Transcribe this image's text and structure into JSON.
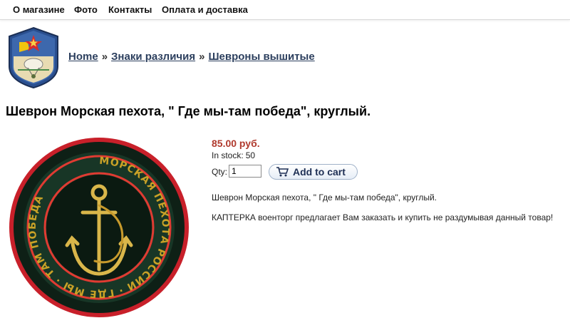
{
  "nav": {
    "items": [
      {
        "label": "О магазине"
      },
      {
        "label": "Фото"
      },
      {
        "label": "Контакты"
      },
      {
        "label": "Оплата и доставка"
      }
    ]
  },
  "breadcrumb": {
    "items": [
      {
        "label": "Home"
      },
      {
        "label": "Знаки различия"
      },
      {
        "label": "Шевроны вышитые"
      }
    ],
    "separator": "»"
  },
  "product": {
    "title": "Шеврон Морская пехота, \" Где мы-там победа\", круглый.",
    "price": "85.00 руб.",
    "stock_label": "In stock:",
    "stock_value": "50",
    "qty_label": "Qty:",
    "qty_value": "1",
    "add_to_cart_label": "Add to cart",
    "description": "Шеврон Морская пехота, \" Где мы-там победа\", круглый.",
    "promo": "КАПТЕРКА военторг предлагает Вам заказать и купить не раздумывая данный товар!",
    "patch_text": "МОРСКАЯ ПЕХОТА РОССИИ · ГДЕ МЫ · ТАМ ПОБЕДА"
  },
  "colors": {
    "price": "#b03a2e",
    "breadcrumb_link": "#2c3f5e",
    "button_text": "#1e2f54"
  }
}
